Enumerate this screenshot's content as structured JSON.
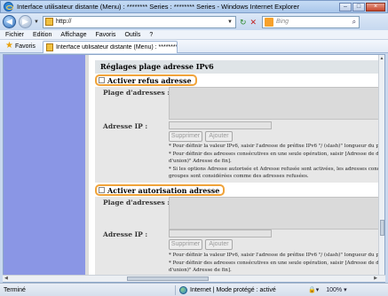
{
  "window": {
    "title": "Interface utilisateur distante (Menu) : ******** Series : ******** Series - Windows Internet Explorer",
    "minimize": "–",
    "maximize": "□",
    "close": "×"
  },
  "nav": {
    "back": "◀",
    "forward": "▶",
    "history_dropdown": "▼",
    "address": "http://",
    "address_dropdown": "▼",
    "refresh": "↻",
    "stop": "✕",
    "search_placeholder": "Bing",
    "search_icon": "⌕"
  },
  "menu": {
    "items": [
      "Fichier",
      "Edition",
      "Affichage",
      "Favoris",
      "Outils",
      "?"
    ]
  },
  "favorites": {
    "star": "★",
    "label": "Favoris",
    "tab_label": "Interface utilisateur distante (Menu) : ******** Seri..."
  },
  "content": {
    "section_title": "Réglages plage adresse IPv6",
    "deny": {
      "checkbox_label": "Activer refus adresse",
      "addresses_label": "Plage d'adresses :",
      "ip_label": "Adresse IP :",
      "delete_button": "Supprimer",
      "add_button": "Ajouter",
      "notes": [
        "* Pour définir la valeur IPv6, saisir l'adresse de préfixe IPv6 \"/ (slash)\" longueur du poi",
        "* Pour définir des adresses consécutives en une seule opération, saisir [Adresse de dé",
        "d'union)\" Adresse de fin].",
        "* Si les options Adresse autorisée et Adresse refusée sont activées, les adresses conc",
        "groupes sont considérées comme des adresses refusées."
      ]
    },
    "allow": {
      "checkbox_label": "Activer autorisation adresse",
      "addresses_label": "Plage d'adresses :",
      "ip_label": "Adresse IP :",
      "delete_button": "Supprimer",
      "add_button": "Ajouter",
      "notes": [
        "* Pour définir la valeur IPv6, saisir l'adresse de préfixe IPv6 \"/ (slash)\" longueur du poi",
        "* Pour définir des adresses consécutives en une seule opération, saisir [Adresse de dé",
        "d'union)\" Adresse de fin]."
      ]
    }
  },
  "status": {
    "text": "Terminé",
    "zone": "Internet | Mode protégé : activé",
    "security": "🔒▾",
    "zoom": "100%",
    "zoom_dropdown": "▾"
  }
}
